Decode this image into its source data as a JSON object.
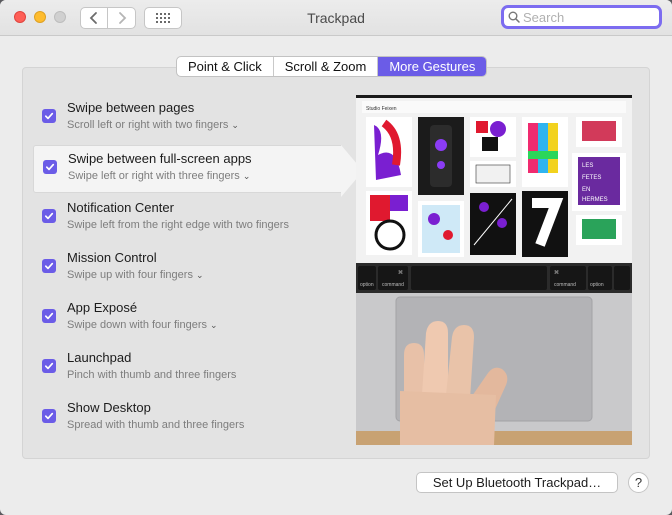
{
  "window": {
    "title": "Trackpad"
  },
  "search": {
    "placeholder": "Search"
  },
  "tabs": [
    {
      "label": "Point & Click",
      "active": false
    },
    {
      "label": "Scroll & Zoom",
      "active": false
    },
    {
      "label": "More Gestures",
      "active": true
    }
  ],
  "gestures": [
    {
      "title": "Swipe between pages",
      "subtitle": "Scroll left or right with two fingers",
      "checked": true,
      "has_menu": true
    },
    {
      "title": "Swipe between full-screen apps",
      "subtitle": "Swipe left or right with three fingers",
      "checked": true,
      "has_menu": true,
      "selected": true
    },
    {
      "title": "Notification Center",
      "subtitle": "Swipe left from the right edge with two fingers",
      "checked": true,
      "has_menu": false
    },
    {
      "title": "Mission Control",
      "subtitle": "Swipe up with four fingers",
      "checked": true,
      "has_menu": true
    },
    {
      "title": "App Exposé",
      "subtitle": "Swipe down with four fingers",
      "checked": true,
      "has_menu": true
    },
    {
      "title": "Launchpad",
      "subtitle": "Pinch with thumb and three fingers",
      "checked": true,
      "has_menu": false
    },
    {
      "title": "Show Desktop",
      "subtitle": "Spread with thumb and three fingers",
      "checked": true,
      "has_menu": false
    }
  ],
  "preview": {
    "studio_name": "Studio Feixen",
    "keyboard_keys": [
      "⌘",
      "command",
      "⌘",
      "command",
      "option",
      "option"
    ]
  },
  "footer": {
    "setup_label": "Set Up Bluetooth Trackpad…",
    "help_label": "?"
  },
  "colors": {
    "accent": "#6b5ce7",
    "window_bg": "#ececec",
    "panel_bg": "#e3e3e3"
  }
}
